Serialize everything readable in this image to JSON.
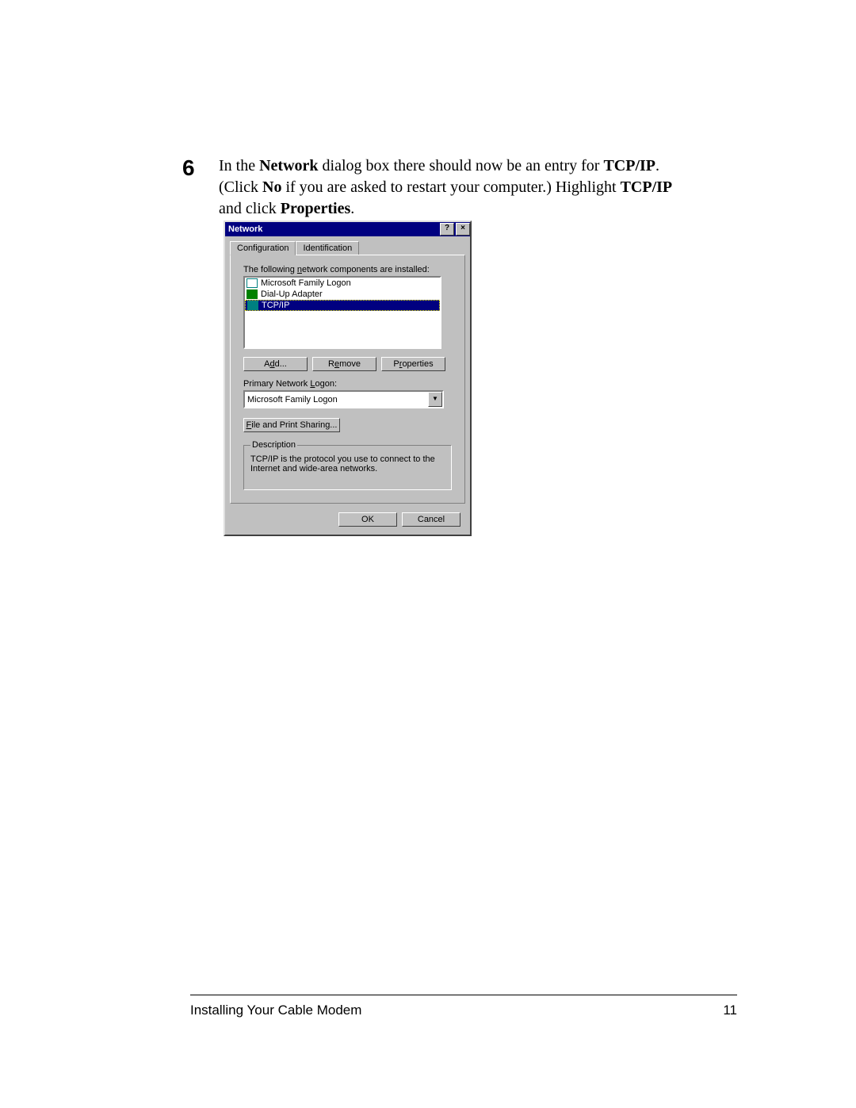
{
  "step": {
    "number": "6",
    "t1": "In the ",
    "b1": "Network",
    "t2": " dialog box there should now be an entry for ",
    "b2": "TCP/IP",
    "t3": ". (Click ",
    "b3": "No",
    "t4": " if you are asked to restart your computer.) Highlight ",
    "b4": "TCP/IP",
    "t5": " and click ",
    "b5": "Properties",
    "t6": "."
  },
  "dialog": {
    "title": "Network",
    "help_btn": "?",
    "close_btn": "×",
    "tabs": {
      "configuration": "Configuration",
      "identification": "Identification"
    },
    "components_label_pre": "The following ",
    "components_label_key": "n",
    "components_label_post": "etwork components are installed:",
    "items": {
      "0": "Microsoft Family Logon",
      "1": "Dial-Up Adapter",
      "2": "TCP/IP"
    },
    "add_pre": "A",
    "add_key": "d",
    "add_post": "d...",
    "remove_pre": "R",
    "remove_key": "e",
    "remove_post": "move",
    "properties_pre": "P",
    "properties_key": "r",
    "properties_post": "operties",
    "logon_label_pre": "Primary Network ",
    "logon_label_key": "L",
    "logon_label_post": "ogon:",
    "logon_value": "Microsoft Family Logon",
    "fps_pre": "",
    "fps_key": "F",
    "fps_post": "ile and Print Sharing...",
    "desc_legend": "Description",
    "desc_text": "TCP/IP is the protocol you use to connect to the Internet and wide-area networks.",
    "ok": "OK",
    "cancel": "Cancel"
  },
  "footer": {
    "title": "Installing Your Cable Modem",
    "page": "11"
  }
}
